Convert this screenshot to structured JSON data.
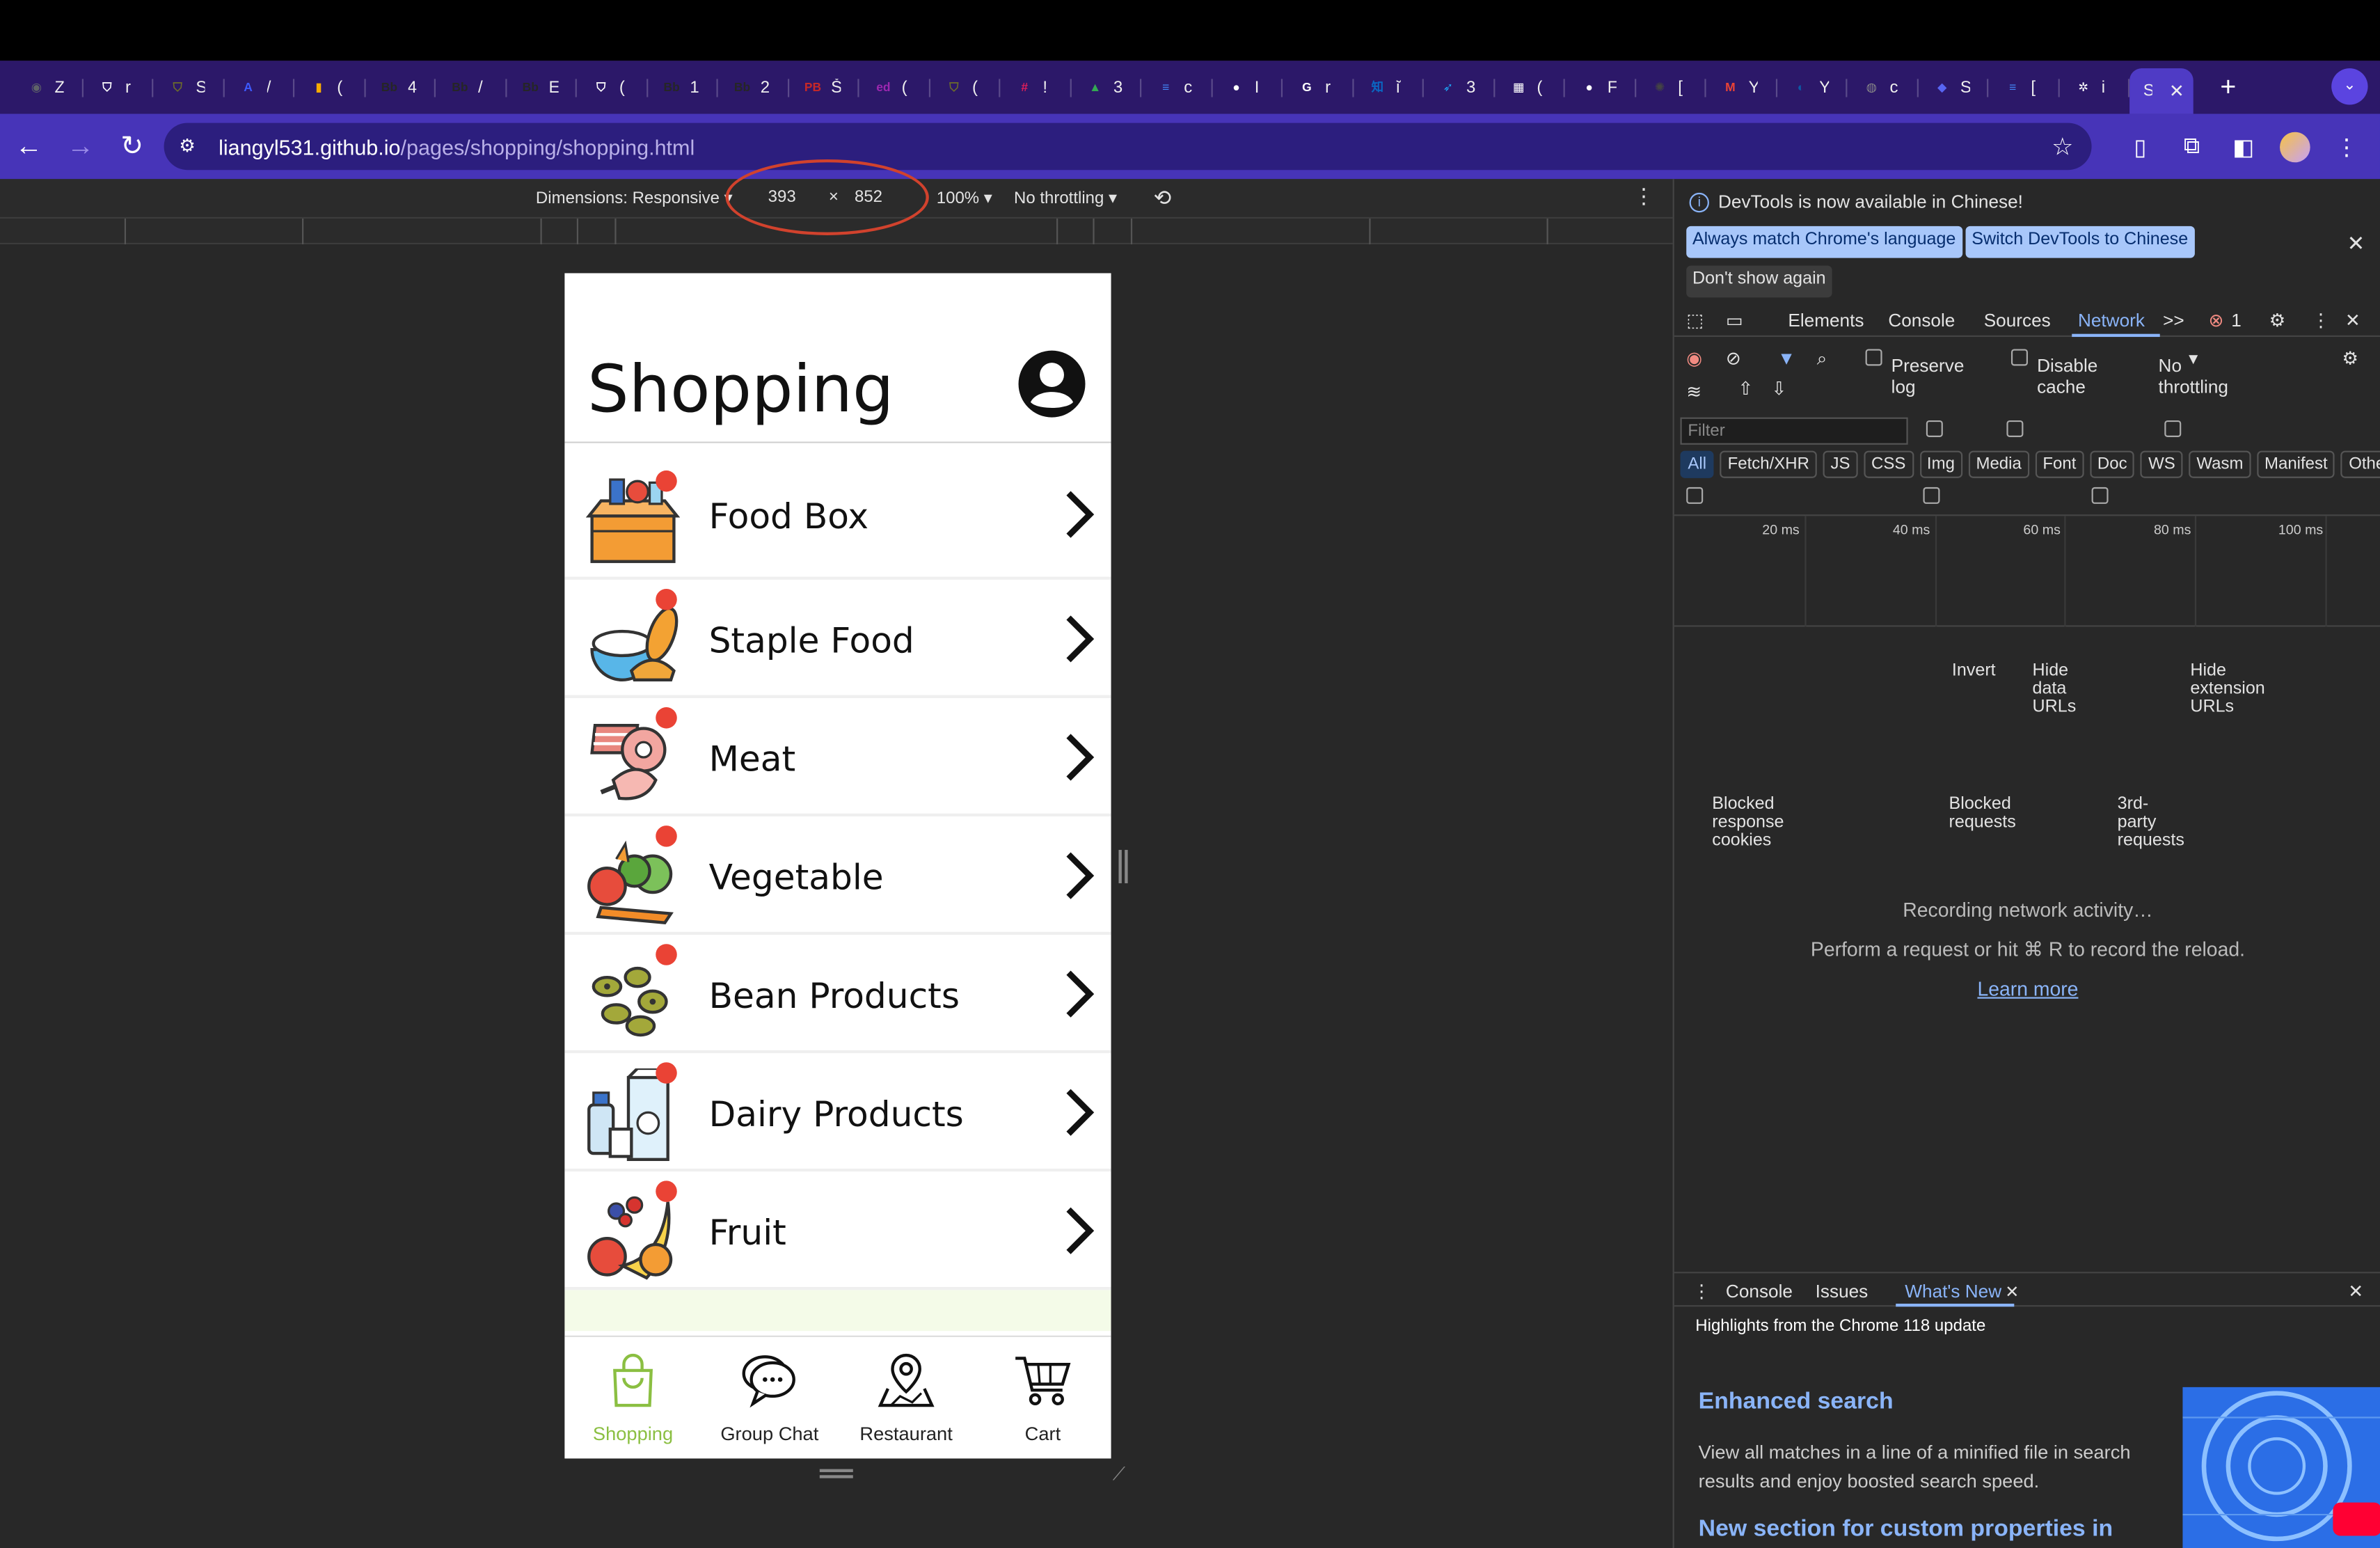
{
  "browser": {
    "tabs": [
      {
        "icon": "chrome-icon",
        "color": "#5f6368",
        "glyph": "◉",
        "title": "Z"
      },
      {
        "icon": "shield-icon",
        "color": "#ffffff",
        "glyph": "⛉",
        "title": "r"
      },
      {
        "icon": "crest-icon",
        "color": "#6d6d2a",
        "glyph": "⛉",
        "title": "S"
      },
      {
        "icon": "translate-icon",
        "color": "#3d5afe",
        "glyph": "A",
        "title": "/"
      },
      {
        "icon": "chart-icon",
        "color": "#f9ab00",
        "glyph": "▮",
        "title": "("
      },
      {
        "icon": "blackboard-icon",
        "color": "#262626",
        "glyph": "Bb",
        "title": "4"
      },
      {
        "icon": "blackboard-icon",
        "color": "#262626",
        "glyph": "Bb",
        "title": "/"
      },
      {
        "icon": "blackboard-icon",
        "color": "#262626",
        "glyph": "Bb",
        "title": "E"
      },
      {
        "icon": "shield-icon",
        "color": "#ffffff",
        "glyph": "⛉",
        "title": "("
      },
      {
        "icon": "blackboard-icon",
        "color": "#262626",
        "glyph": "Bb",
        "title": "1"
      },
      {
        "icon": "blackboard-icon",
        "color": "#262626",
        "glyph": "Bb",
        "title": "2"
      },
      {
        "icon": "pb-icon",
        "color": "#c62828",
        "glyph": "PB",
        "title": "Š"
      },
      {
        "icon": "ed-icon",
        "color": "#9c27b0",
        "glyph": "ed",
        "title": "("
      },
      {
        "icon": "crest-icon",
        "color": "#6d6d2a",
        "glyph": "⛉",
        "title": "("
      },
      {
        "icon": "slack-icon",
        "color": "#e01e5a",
        "glyph": "#",
        "title": "!"
      },
      {
        "icon": "drive-icon",
        "color": "#34a853",
        "glyph": "▲",
        "title": "3"
      },
      {
        "icon": "docs-icon",
        "color": "#4285f4",
        "glyph": "≡",
        "title": "c"
      },
      {
        "icon": "github-icon",
        "color": "#ffffff",
        "glyph": "●",
        "title": "I"
      },
      {
        "icon": "google-icon",
        "color": "#ffffff",
        "glyph": "G",
        "title": "r"
      },
      {
        "icon": "zhihu-icon",
        "color": "#0a66c2",
        "glyph": "知",
        "title": "ĩ"
      },
      {
        "icon": "bird-icon",
        "color": "#1da1f2",
        "glyph": "➶",
        "title": "3"
      },
      {
        "icon": "calculator-icon",
        "color": "#ffffff",
        "glyph": "▦",
        "title": "("
      },
      {
        "icon": "github-icon",
        "color": "#ffffff",
        "glyph": "●",
        "title": "F"
      },
      {
        "icon": "openai-icon",
        "color": "#444444",
        "glyph": "✺",
        "title": "["
      },
      {
        "icon": "gmail-icon",
        "color": "#ea4335",
        "glyph": "M",
        "title": "Y"
      },
      {
        "icon": "edge-icon",
        "color": "#0c59a4",
        "glyph": "◐",
        "title": "Y"
      },
      {
        "icon": "globe-icon",
        "color": "#888888",
        "glyph": "◍",
        "title": "c"
      },
      {
        "icon": "chat-icon",
        "color": "#5865f2",
        "glyph": "◆",
        "title": "S"
      },
      {
        "icon": "docs-icon",
        "color": "#4285f4",
        "glyph": "≡",
        "title": "["
      },
      {
        "icon": "settings-icon",
        "color": "#ffffff",
        "glyph": "✲",
        "title": "i"
      }
    ],
    "active_tab_title": "S",
    "url_host": "liangyl531.github.io",
    "url_path": "/pages/shopping/shopping.html"
  },
  "device_toolbar": {
    "dimensions_label": "Dimensions: Responsive",
    "width": "393",
    "times": "×",
    "height": "852",
    "zoom": "100%",
    "throttling": "No throttling"
  },
  "app": {
    "title": "Shopping",
    "categories": [
      {
        "label": "Food Box"
      },
      {
        "label": "Staple Food"
      },
      {
        "label": "Meat"
      },
      {
        "label": "Vegetable"
      },
      {
        "label": "Bean Products"
      },
      {
        "label": "Dairy Products"
      },
      {
        "label": "Fruit"
      }
    ],
    "nav": [
      {
        "label": "Shopping"
      },
      {
        "label": "Group Chat"
      },
      {
        "label": "Restaurant"
      },
      {
        "label": "Cart"
      }
    ],
    "accent_color": "#8bbf42"
  },
  "devtools": {
    "banner": "DevTools is now available in Chinese!",
    "btn_match": "Always match Chrome's language",
    "btn_switch": "Switch DevTools to Chinese",
    "btn_dont_show": "Don't show again",
    "tabs": [
      "Elements",
      "Console",
      "Sources",
      "Network"
    ],
    "more_tabs": ">>",
    "error_count": "1",
    "preserve_log": "Preserve log",
    "disable_cache": "Disable cache",
    "throttling": "No throttling",
    "filter_placeholder": "Filter",
    "invert": "Invert",
    "hide_data_urls": "Hide data URLs",
    "hide_extension_urls": "Hide extension URLs",
    "types": [
      "All",
      "Fetch/XHR",
      "JS",
      "CSS",
      "Img",
      "Media",
      "Font",
      "Doc",
      "WS",
      "Wasm",
      "Manifest",
      "Other"
    ],
    "blocked_cookies": "Blocked response cookies",
    "blocked_requests": "Blocked requests",
    "third_party": "3rd-party requests",
    "timeline_ticks": [
      "20 ms",
      "40 ms",
      "60 ms",
      "80 ms",
      "100 ms"
    ],
    "recording": "Recording network activity…",
    "perform": "Perform a request or hit ⌘ R to record the reload.",
    "learn_more": "Learn more",
    "drawer_tabs": [
      "Console",
      "Issues",
      "What's New"
    ],
    "whats_new_highlights": "Highlights from the Chrome 118 update",
    "enhanced_search_title": "Enhanced search",
    "enhanced_search_body": "View all matches in a line of a minified file in search results and enjoy boosted search speed.",
    "new_section_title": "New section for custom properties in"
  }
}
